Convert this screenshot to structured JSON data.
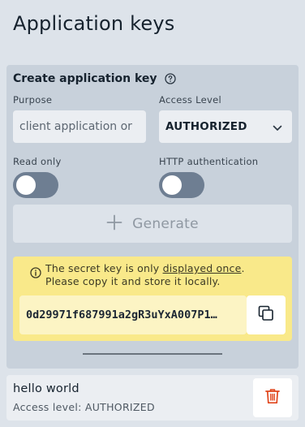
{
  "page": {
    "title": "Application keys"
  },
  "create": {
    "title": "Create application key",
    "purpose_label": "Purpose",
    "purpose_placeholder": "client application or",
    "access_label": "Access Level",
    "access_value": "AUTHORIZED",
    "read_only_label": "Read only",
    "read_only_on": false,
    "http_auth_label": "HTTP authentication",
    "http_auth_on": false,
    "generate_label": "Generate"
  },
  "notice": {
    "text_before": "The secret key is only ",
    "text_link": "displayed once",
    "text_after": ". Please copy it and store it locally.",
    "secret_key": "0d29971f687991a2gR3uYxA007P1…"
  },
  "keys": [
    {
      "name": "hello world",
      "access": "Access level: AUTHORIZED"
    }
  ],
  "colors": {
    "background": "#dde3ea",
    "card": "#c8d1db",
    "notice": "#f9e98a",
    "toggle_off": "#6e7e92",
    "delete_accent": "#e0451b"
  }
}
